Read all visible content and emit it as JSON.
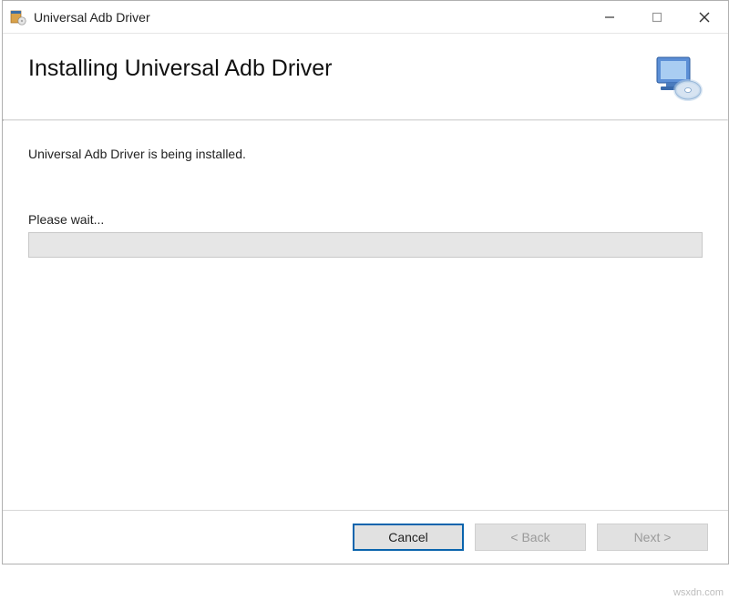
{
  "titlebar": {
    "title": "Universal Adb Driver"
  },
  "header": {
    "title": "Installing Universal Adb Driver"
  },
  "content": {
    "status": "Universal Adb Driver is being installed.",
    "wait": "Please wait..."
  },
  "footer": {
    "cancel": "Cancel",
    "back": "< Back",
    "next": "Next >"
  },
  "watermark": "wsxdn.com"
}
